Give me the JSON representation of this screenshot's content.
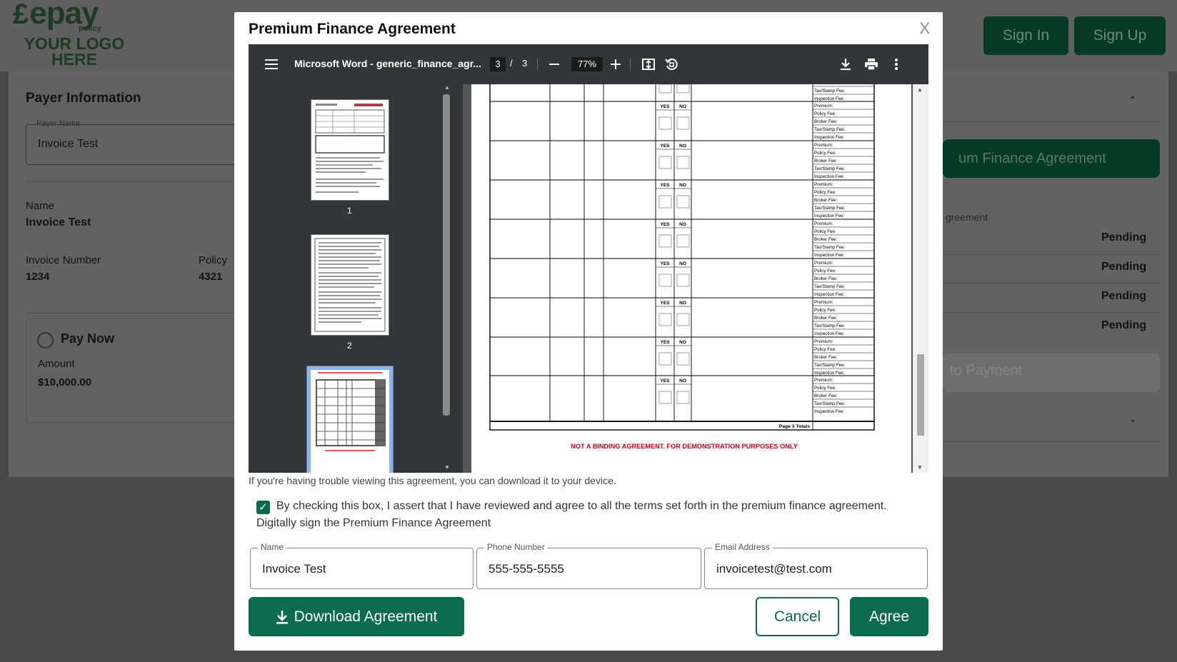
{
  "background": {
    "logo": {
      "brand": "epay",
      "sub": "policy",
      "tagline_1": "YOUR LOGO",
      "tagline_2": "HERE"
    },
    "header_buttons": {
      "sign_in": "Sign In",
      "sign_up": "Sign Up"
    },
    "payer": {
      "section_title": "Payer Information",
      "payer_name_label": "Payer Name",
      "payer_name_value": "Invoice Test",
      "name_label": "Name",
      "name_value": "Invoice Test",
      "invoice_number_label": "Invoice Number",
      "invoice_number_value": "1234",
      "policy_label": "Policy",
      "policy_value": "4321",
      "pay_now_label": "Pay Now",
      "amount_label": "Amount",
      "amount_value": "$10,000.00"
    },
    "right": {
      "agreement_button": "um Finance Agreement",
      "agreement_caption": "greement",
      "statuses": [
        "Pending",
        "Pending",
        "Pending",
        "Pending"
      ],
      "payment_button": "to Payment"
    }
  },
  "modal": {
    "title": "Premium Finance Agreement",
    "close_label": "X",
    "viewer": {
      "doc_title": "Microsoft Word - generic_finance_agr...",
      "current_page": "3",
      "page_separator": "/",
      "total_pages": "3",
      "zoom": "77%",
      "thumbnail_numbers": [
        "1",
        "2"
      ],
      "page": {
        "yes_label": "YES",
        "no_label": "NO",
        "fee_labels": [
          "Premium:",
          "Policy Fee:",
          "Broker Fee:",
          "Tax/Stamp Fee:",
          "Inspection Fee:"
        ],
        "totals_label": "Page 3 Totals",
        "footer_notice": "NOT A BINDING AGREEMENT. FOR DEMONSTRATION PURPOSES ONLY"
      }
    },
    "trouble_text": "If you're having trouble viewing this agreement, you can download it to your device.",
    "agree_checkbox_checked": true,
    "agree_text": "By checking this box, I assert that I have reviewed and agree to all the terms set forth in the premium finance agreement. Digitally sign the Premium Finance Agreement",
    "fields": {
      "name_label": "Name",
      "name_value": "Invoice Test",
      "phone_label": "Phone Number",
      "phone_value": "555-555-5555",
      "email_label": "Email Address",
      "email_value": "invoicetest@test.com"
    },
    "buttons": {
      "download": "Download Agreement",
      "cancel": "Cancel",
      "agree": "Agree"
    },
    "colors": {
      "primary": "#0a6b4e",
      "viewer_toolbar": "#323639",
      "notice_red": "#d0021b"
    }
  }
}
